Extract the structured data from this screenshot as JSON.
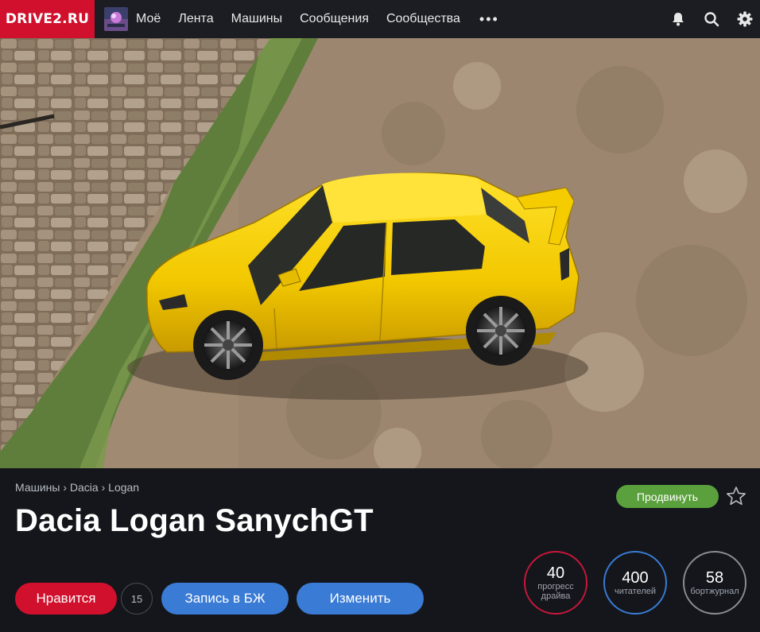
{
  "header": {
    "logo": "DRIVE2.RU",
    "nav": [
      "Моё",
      "Лента",
      "Машины",
      "Сообщения",
      "Сообщества"
    ],
    "more": "•••",
    "icons": [
      "bell-icon",
      "search-icon",
      "gear-icon"
    ]
  },
  "car": {
    "breadcrumb": [
      "Машины",
      "Dacia",
      "Logan"
    ],
    "breadcrumb_sep": "›",
    "title": "Dacia Logan SanychGT",
    "promote_label": "Продвинуть",
    "like_label": "Нравится",
    "like_count": "15",
    "logbook_button": "Запись в БЖ",
    "edit_button": "Изменить"
  },
  "stats": {
    "progress": {
      "value": "40",
      "label": "прогресс драйва"
    },
    "readers": {
      "value": "400",
      "label": "читателей"
    },
    "logbook": {
      "value": "58",
      "label": "бортжурнал"
    }
  },
  "colors": {
    "brand": "#d0102c",
    "accent_blue": "#3a7bd5",
    "promote_green": "#5aa03c",
    "car_yellow": "#f2cc00"
  }
}
